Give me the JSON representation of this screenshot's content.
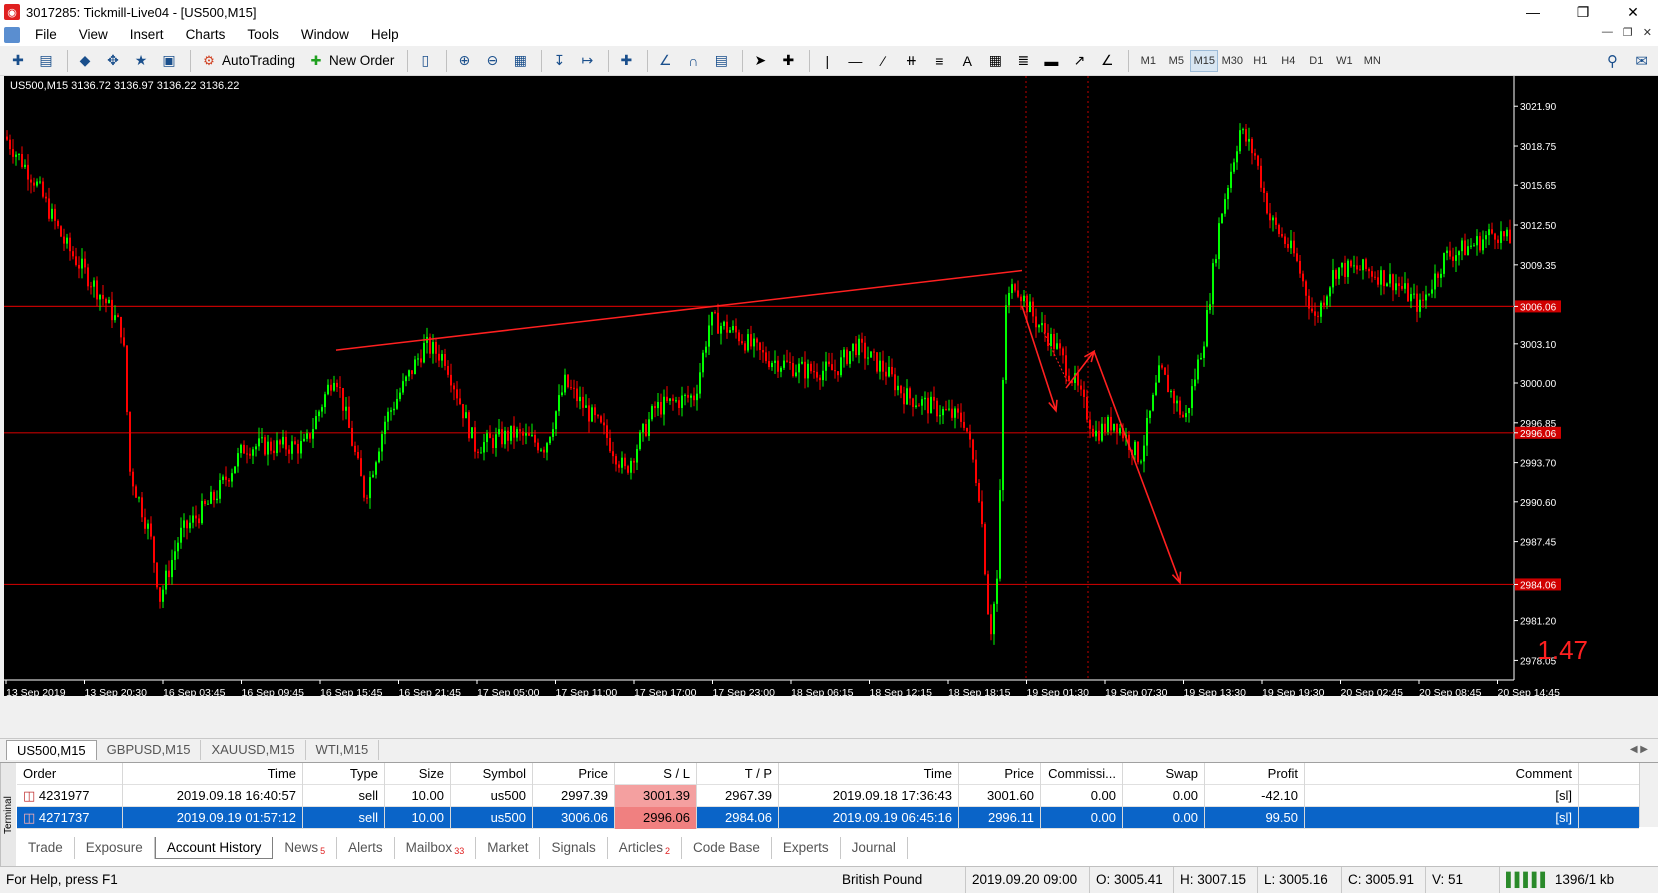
{
  "window": {
    "title": "3017285: Tickmill-Live04 - [US500,M15]"
  },
  "menu": [
    "File",
    "View",
    "Insert",
    "Charts",
    "Tools",
    "Window",
    "Help"
  ],
  "toolbar": {
    "autotrading_label": "AutoTrading",
    "new_order_label": "New Order",
    "timeframes": [
      "M1",
      "M5",
      "M15",
      "M30",
      "H1",
      "H4",
      "D1",
      "W1",
      "MN"
    ],
    "active_timeframe": "M15"
  },
  "chart": {
    "symbol_info": "US500,M15  3136.72 3136.97 3136.22 3136.22",
    "big_number": "1.47",
    "price_labels": [
      "3021.90",
      "3018.75",
      "3015.65",
      "3012.50",
      "3009.35",
      "3006.06",
      "3003.10",
      "3000.00",
      "2996.85",
      "2996.06",
      "2993.70",
      "2990.60",
      "2987.45",
      "2984.06",
      "2981.20",
      "2978.05"
    ],
    "time_labels": [
      "13 Sep 2019",
      "13 Sep 20:30",
      "16 Sep 03:45",
      "16 Sep 09:45",
      "16 Sep 15:45",
      "16 Sep 21:45",
      "17 Sep 05:00",
      "17 Sep 11:00",
      "17 Sep 17:00",
      "17 Sep 23:00",
      "18 Sep 06:15",
      "18 Sep 12:15",
      "18 Sep 18:15",
      "19 Sep 01:30",
      "19 Sep 07:30",
      "19 Sep 13:30",
      "19 Sep 19:30",
      "20 Sep 02:45",
      "20 Sep 08:45",
      "20 Sep 14:45"
    ],
    "hlines": [
      "3006.06",
      "2996.06",
      "2984.06"
    ],
    "colors": {
      "bull": "#00ff00",
      "bear": "#ff0000",
      "hline": "#c00000",
      "background": "#000000"
    }
  },
  "chart_tabs": [
    "US500,M15",
    "GBPUSD,M15",
    "XAUUSD,M15",
    "WTI,M15"
  ],
  "terminal": {
    "side_label": "Terminal",
    "columns": [
      "Order",
      "Time",
      "Type",
      "Size",
      "Symbol",
      "Price",
      "S / L",
      "T / P",
      "Time",
      "Price",
      "Commissi...",
      "Swap",
      "Profit",
      "Comment"
    ],
    "rows": [
      [
        "4231977",
        "2019.09.18 16:40:57",
        "sell",
        "10.00",
        "us500",
        "2997.39",
        "3001.39",
        "2967.39",
        "2019.09.18 17:36:43",
        "3001.60",
        "0.00",
        "0.00",
        "-42.10",
        "[sl]"
      ],
      [
        "4271737",
        "2019.09.19 01:57:12",
        "sell",
        "10.00",
        "us500",
        "3006.06",
        "2996.06",
        "2984.06",
        "2019.09.19 06:45:16",
        "2996.11",
        "0.00",
        "0.00",
        "99.50",
        "[sl]"
      ]
    ],
    "tabs": [
      {
        "label": "Trade",
        "badge": ""
      },
      {
        "label": "Exposure",
        "badge": ""
      },
      {
        "label": "Account History",
        "badge": ""
      },
      {
        "label": "News",
        "badge": "5"
      },
      {
        "label": "Alerts",
        "badge": ""
      },
      {
        "label": "Mailbox",
        "badge": "33"
      },
      {
        "label": "Market",
        "badge": ""
      },
      {
        "label": "Signals",
        "badge": ""
      },
      {
        "label": "Articles",
        "badge": "2"
      },
      {
        "label": "Code Base",
        "badge": ""
      },
      {
        "label": "Experts",
        "badge": ""
      },
      {
        "label": "Journal",
        "badge": ""
      }
    ],
    "active_tab": "Account History"
  },
  "status": {
    "help": "For Help, press F1",
    "profile": "British Pound",
    "datetime": "2019.09.20 09:00",
    "open": "O: 3005.41",
    "high": "H: 3007.15",
    "low": "L: 3005.16",
    "close": "C: 3005.91",
    "volume": "V: 51",
    "traffic": "1396/1 kb"
  }
}
